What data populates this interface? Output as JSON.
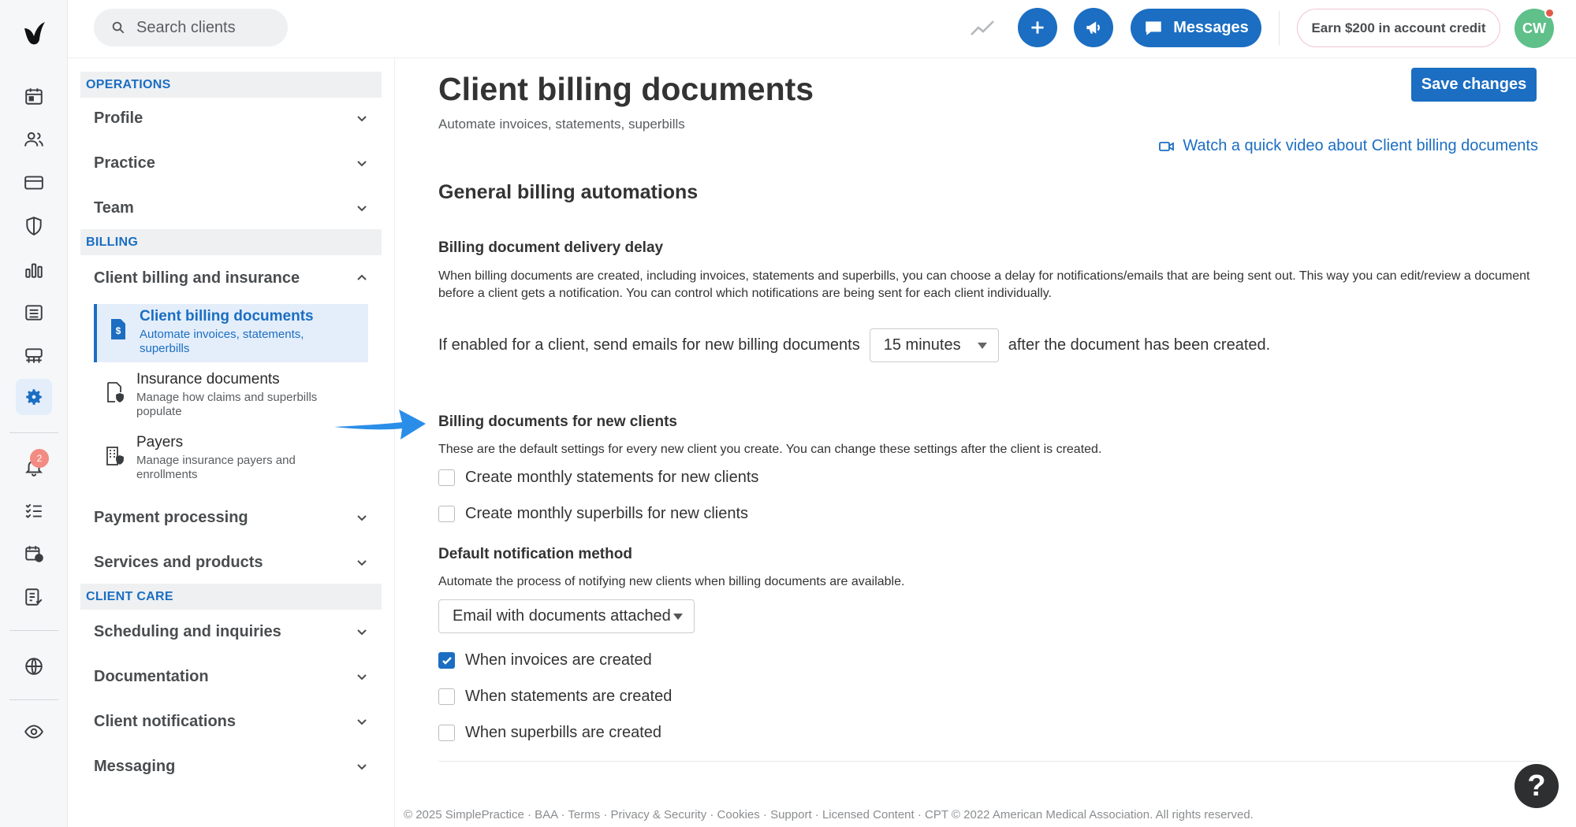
{
  "app": {
    "search_placeholder": "Search clients",
    "messages_label": "Messages",
    "earn_label": "Earn $200 in account credit",
    "avatar_initials": "CW",
    "notification_count": "2",
    "icons": [
      "logo-icon",
      "calendar-icon",
      "clients-icon",
      "billing-icon",
      "shield-icon",
      "analytics-icon",
      "list-icon",
      "marketplace-icon",
      "settings-icon",
      "bell-icon",
      "tasks-icon",
      "calendar-check-icon",
      "reports-icon",
      "globe-icon",
      "eye-icon"
    ]
  },
  "sidebar": {
    "sections": [
      {
        "heading": "OPERATIONS",
        "items": [
          "Profile",
          "Practice",
          "Team"
        ]
      },
      {
        "heading": "BILLING",
        "items": [
          "Client billing and insurance",
          "Payment processing",
          "Services and products"
        ]
      },
      {
        "heading": "CLIENT CARE",
        "items": [
          "Scheduling and inquiries",
          "Documentation",
          "Client notifications",
          "Messaging"
        ]
      }
    ],
    "subitems": [
      {
        "title": "Client billing documents",
        "desc": "Automate invoices, statements, superbills",
        "active": true
      },
      {
        "title": "Insurance documents",
        "desc": "Manage how claims and superbills populate",
        "active": false
      },
      {
        "title": "Payers",
        "desc": "Manage insurance payers and enrollments",
        "active": false
      }
    ]
  },
  "main": {
    "title": "Client billing documents",
    "subtitle": "Automate invoices, statements, superbills",
    "save_label": "Save changes",
    "video_link": "Watch a quick video about Client billing documents",
    "section_title": "General billing automations",
    "delay": {
      "heading": "Billing document delivery delay",
      "text": "When billing documents are created, including invoices, statements and superbills, you can choose a delay for notifications/emails that are being sent out. This way you can edit/review a document before a client gets a notification. You can control which notifications are being sent for each client individually.",
      "prefix": "If enabled for a client, send emails for new billing documents",
      "value": "15 minutes",
      "suffix": "after the document has been created."
    },
    "new_clients": {
      "heading": "Billing documents for new clients",
      "text": "These are the default settings for every new client you create. You can change these settings after the client is created.",
      "options": [
        {
          "label": "Create monthly statements for new clients",
          "checked": false
        },
        {
          "label": "Create monthly superbills for new clients",
          "checked": false
        }
      ]
    },
    "notification": {
      "heading": "Default notification method",
      "text": "Automate the process of notifying new clients when billing documents are available.",
      "method": "Email with documents attached",
      "options": [
        {
          "label": "When invoices are created",
          "checked": true
        },
        {
          "label": "When statements are created",
          "checked": false
        },
        {
          "label": "When superbills are created",
          "checked": false
        }
      ]
    },
    "footer": "© 2025 SimplePractice · BAA · Terms · Privacy & Security · Cookies · Support · Licensed Content · CPT © 2022 American Medical Association. All rights reserved.",
    "help_label": "?"
  },
  "colors": {
    "accent": "#1b6ec2",
    "avatar": "#5fc08a",
    "badge": "#f28b82"
  }
}
